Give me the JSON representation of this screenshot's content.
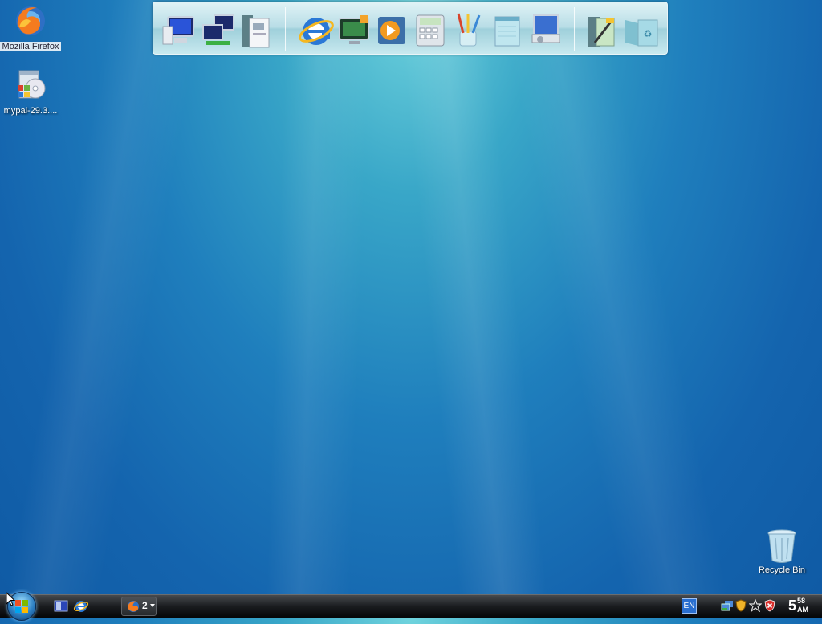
{
  "desktop": {
    "icons": [
      {
        "label": "Mozilla Firefox",
        "icon": "firefox-icon"
      },
      {
        "label": "mypal-29.3....",
        "icon": "installer-disc-icon"
      },
      {
        "label": "Recycle Bin",
        "icon": "recycle-bin-icon"
      }
    ]
  },
  "dock": {
    "items": [
      {
        "icon": "computer-icon"
      },
      {
        "icon": "network-icon"
      },
      {
        "icon": "documents-icon"
      },
      {
        "icon": "internet-explorer-icon"
      },
      {
        "icon": "media-center-icon"
      },
      {
        "icon": "media-player-icon"
      },
      {
        "icon": "calculator-icon"
      },
      {
        "icon": "paint-icon"
      },
      {
        "icon": "notepad-icon"
      },
      {
        "icon": "control-panel-icon"
      },
      {
        "icon": "tools-icon"
      },
      {
        "icon": "recycle-bin-icon"
      }
    ]
  },
  "taskbar": {
    "quick_launch": [
      {
        "icon": "show-desktop-icon"
      },
      {
        "icon": "internet-explorer-icon"
      }
    ],
    "task_group": {
      "icon": "firefox-icon",
      "count": "2"
    },
    "tray": {
      "language": "EN",
      "icons": [
        {
          "icon": "network-icon"
        },
        {
          "icon": "shield-icon"
        },
        {
          "icon": "star-icon"
        },
        {
          "icon": "security-alert-icon"
        }
      ]
    },
    "clock": {
      "hour": "5",
      "minute": "58",
      "period": "AM"
    }
  },
  "colors": {
    "desktop_top": "#6fd3dd",
    "desktop_bottom": "#0f5aa4",
    "taskbar": "#1a1c1f"
  }
}
